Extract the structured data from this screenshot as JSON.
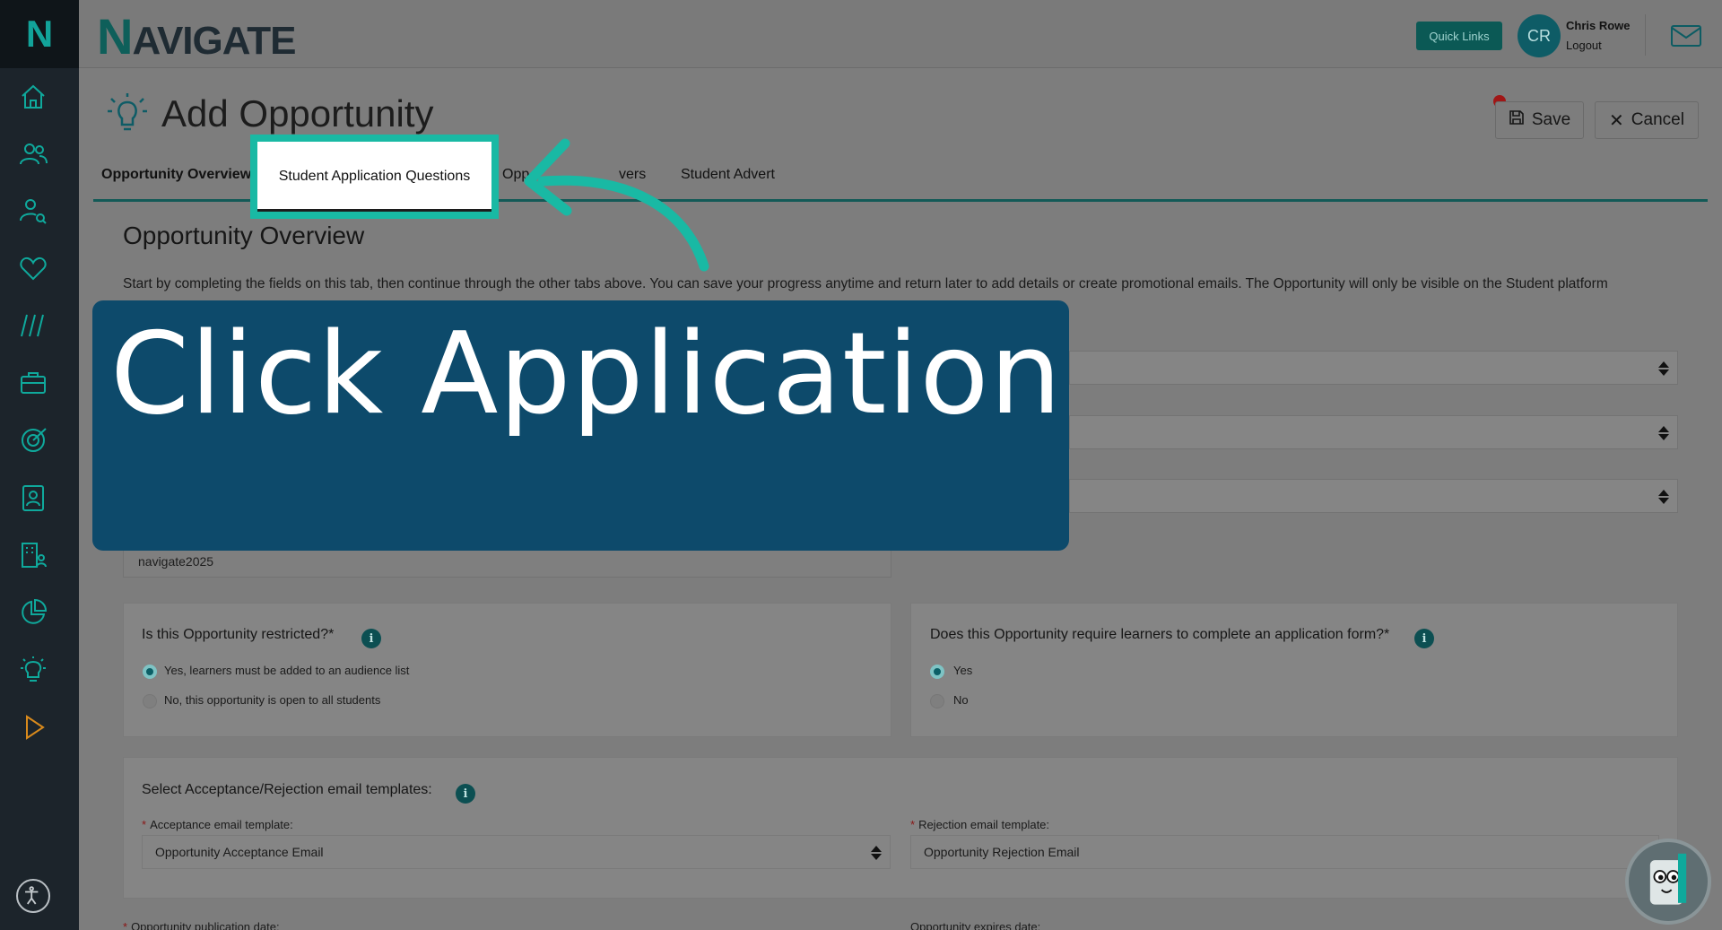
{
  "sidebar": {
    "logo": "N",
    "items": [
      {
        "icon": "home-icon"
      },
      {
        "icon": "users-icon"
      },
      {
        "icon": "user-search-icon"
      },
      {
        "icon": "heart-icon"
      },
      {
        "icon": "slashes-icon"
      },
      {
        "icon": "briefcase-icon"
      },
      {
        "icon": "target-icon"
      },
      {
        "icon": "contact-card-icon"
      },
      {
        "icon": "building-user-icon"
      },
      {
        "icon": "pie-chart-icon"
      },
      {
        "icon": "lightbulb-icon"
      },
      {
        "icon": "play-icon"
      }
    ]
  },
  "header": {
    "brand": "AVIGATE",
    "brand_initial": "N",
    "quick_links": "Quick Links",
    "avatar_initials": "CR",
    "user_name": "Chris Rowe",
    "logout": "Logout"
  },
  "page": {
    "title": "Add Opportunity",
    "save": "Save",
    "cancel": "Cancel"
  },
  "tabs": [
    {
      "label": "Opportunity Overview",
      "active": true
    },
    {
      "label": "Student Application Questions"
    },
    {
      "label": "Opp"
    },
    {
      "label": "vers"
    },
    {
      "label": "Student Advert"
    }
  ],
  "overview": {
    "heading": "Opportunity Overview",
    "intro": "Start by completing the fields on this tab, then continue through the other tabs above. You can save your progress anytime and return later to add details or create promotional emails. The Opportunity will only be visible on the Student platform",
    "code_value": "navigate2025"
  },
  "restricted": {
    "question": "Is this Opportunity restricted?*",
    "options": [
      {
        "label": "Yes, learners must be added to an audience list",
        "selected": true
      },
      {
        "label": "No, this opportunity is open to all students",
        "selected": false
      }
    ]
  },
  "application_form": {
    "question": "Does this Opportunity require learners to complete an application form?*",
    "options": [
      {
        "label": "Yes",
        "selected": true
      },
      {
        "label": "No",
        "selected": false
      }
    ]
  },
  "email_templates": {
    "heading": "Select Acceptance/Rejection email templates:",
    "acceptance_label": "Acceptance email template:",
    "acceptance_value": "Opportunity Acceptance Email",
    "rejection_label": "Rejection email template:",
    "rejection_value": "Opportunity Rejection Email"
  },
  "dates": {
    "publication_label": "Opportunity publication date:",
    "expires_label": "Opportunity expires date:"
  },
  "callout": {
    "text": "Click Application"
  },
  "colors": {
    "highlight": "#19b9a4",
    "callout_bg": "#0d4a6b",
    "accent": "#0b5955"
  }
}
